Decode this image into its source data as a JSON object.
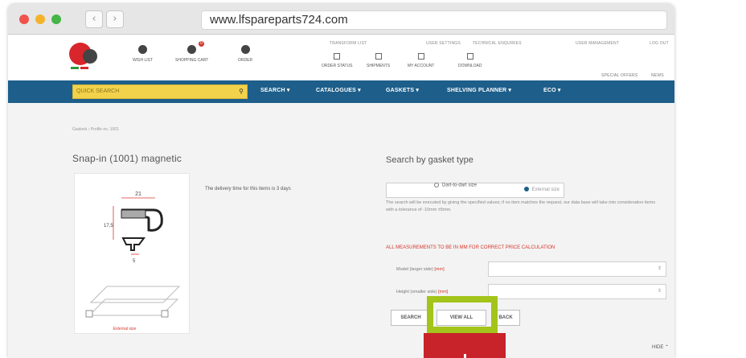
{
  "browser": {
    "url": "www.lfspareparts724.com",
    "back_glyph": "‹",
    "forward_glyph": "›"
  },
  "header": {
    "icons": [
      {
        "label": "WISH LIST",
        "icon": "heart-icon"
      },
      {
        "label": "SHOPPING CART",
        "icon": "cart-icon"
      },
      {
        "label": "ORDER",
        "icon": "order-icon"
      }
    ],
    "toplinks": [
      "TRANSFORM LIST",
      "USER SETTINGS",
      "TECHNICAL ENQUIRIES",
      "USER MANAGEMENT",
      "LOG OUT"
    ],
    "subicons": [
      {
        "label": "ORDER STATUS"
      },
      {
        "label": "SHIPMENTS"
      },
      {
        "label": "MY ACCOUNT"
      },
      {
        "label": "DOWNLOAD"
      }
    ],
    "special_offers": "SPECIAL OFFERS",
    "news": "NEWS",
    "cart_badge": "0"
  },
  "navbar": {
    "quick_search_placeholder": "QUICK SEARCH",
    "search_glyph": "⚲",
    "menus": [
      "SEARCH ▾",
      "CATALOGUES ▾",
      "GASKETS ▾",
      "SHELVING PLANNER ▾",
      "ECO ▾"
    ]
  },
  "breadcrumb": "Gaskets › Profile no. 1001",
  "product": {
    "title": "Snap-in (1001) magnetic",
    "delivery": "The delivery time for this items is 3 days",
    "dim_a": "21",
    "dim_b": "17,5",
    "dim_c": "5",
    "caption": "External size"
  },
  "search": {
    "title": "Search by gasket type",
    "radio_external": "External size",
    "radio_dart": "Dart-to-dart size",
    "description": "The search will be executed by giving the specified values; if no item matches the request, our data base will take into consideration items with a tolerance of -10mm ±5mm.",
    "warning": "ALL MEASUREMENTS TO BE IN MM FOR CORRECT PRICE CALCULATION",
    "field1_label": "Model (larger side)",
    "field1_unit": "[mm]",
    "field2_label": "Height (smaller side)",
    "field2_unit": "[mm]",
    "select_glyph": "⇕",
    "btn_search": "SEARCH",
    "btn_viewall": "VIEW ALL",
    "btn_back": "BACK",
    "hide": "HIDE ⌃"
  },
  "colors": {
    "nav_blue": "#1d5e8a",
    "quick_search_yellow": "#f3d24b",
    "highlight_green": "#a3c41b",
    "warning_red": "#d6362b",
    "cta_red": "#c8222b"
  }
}
